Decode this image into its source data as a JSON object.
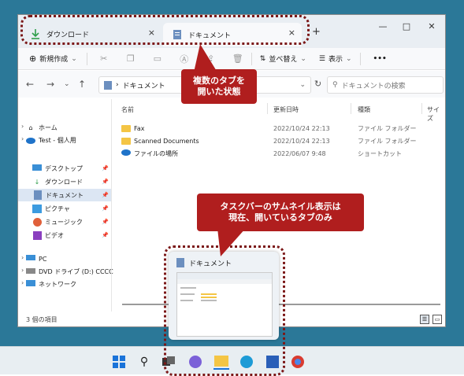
{
  "window": {
    "tabs": [
      {
        "label": "ダウンロード",
        "close": "×"
      },
      {
        "label": "ドキュメント",
        "close": "×"
      }
    ],
    "new_tab": "+",
    "controls": {
      "minimize": "—",
      "maximize": "□",
      "close": "✕"
    }
  },
  "toolbar": {
    "new_label": "新規作成",
    "new_chevron": "⌄",
    "sort_label": "並べ替え",
    "sort_chevron": "⌄",
    "view_label": "表示",
    "view_chevron": "⌄",
    "more_label": "•••"
  },
  "address": {
    "crumb_sep": "›",
    "crumb": "ドキュメント",
    "chevron": "⌄",
    "search_placeholder": "ドキュメントの検索"
  },
  "sidebar": {
    "items": [
      {
        "label": "ホーム",
        "icon": "home-icon"
      },
      {
        "label": "Test - 個人用",
        "icon": "cloud-icon"
      },
      {
        "label": "デスクトップ",
        "icon": "desktop-icon"
      },
      {
        "label": "ダウンロード",
        "icon": "download-icon"
      },
      {
        "label": "ドキュメント",
        "icon": "document-icon"
      },
      {
        "label": "ピクチャ",
        "icon": "pictures-icon"
      },
      {
        "label": "ミュージック",
        "icon": "music-icon"
      },
      {
        "label": "ビデオ",
        "icon": "video-icon"
      },
      {
        "label": "PC",
        "icon": "pc-icon"
      },
      {
        "label": "DVD ドライブ (D:) CCCC",
        "icon": "dvd-icon"
      },
      {
        "label": "ネットワーク",
        "icon": "network-icon"
      }
    ]
  },
  "columns": [
    "名前",
    "更新日時",
    "種類",
    "サイズ"
  ],
  "files": [
    {
      "name": "Fax",
      "date": "2022/10/24 22:13",
      "type": "ファイル フォルダー"
    },
    {
      "name": "Scanned Documents",
      "date": "2022/10/24 22:13",
      "type": "ファイル フォルダー"
    },
    {
      "name": "ファイルの場所",
      "date": "2022/06/07 9:48",
      "type": "ショートカット"
    }
  ],
  "status": "3 個の項目",
  "thumbnail": {
    "title": "ドキュメント"
  },
  "callouts": {
    "tabs_line1": "複数のタブを",
    "tabs_line2": "開いた状態",
    "thumb_line1": "タスクバーのサムネイル表示は",
    "thumb_line2": "現在、開いているタブのみ"
  },
  "colors": {
    "accent": "#b01e1e",
    "folder": "#f4c545",
    "desktop": "#2b7898"
  }
}
